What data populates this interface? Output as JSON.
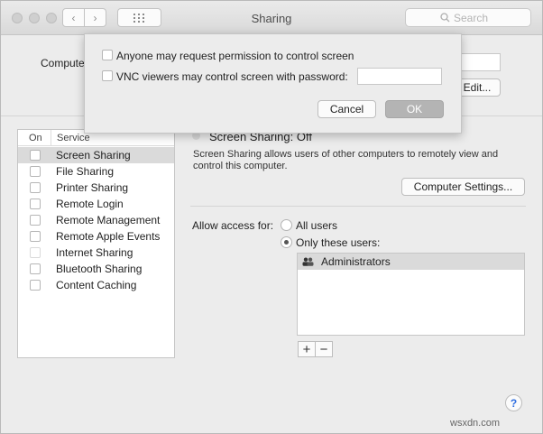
{
  "window": {
    "title": "Sharing"
  },
  "search": {
    "placeholder": "Search"
  },
  "computer_name": {
    "label": "Computer Name:",
    "edit_button": "Edit..."
  },
  "services": {
    "header_on": "On",
    "header_service": "Service",
    "items": [
      {
        "label": "Screen Sharing",
        "selected": true
      },
      {
        "label": "File Sharing"
      },
      {
        "label": "Printer Sharing"
      },
      {
        "label": "Remote Login"
      },
      {
        "label": "Remote Management"
      },
      {
        "label": "Remote Apple Events"
      },
      {
        "label": "Internet Sharing"
      },
      {
        "label": "Bluetooth Sharing"
      },
      {
        "label": "Content Caching"
      }
    ]
  },
  "screen_sharing": {
    "status": "Screen Sharing: Off",
    "description": "Screen Sharing allows users of other computers to remotely view and control this computer.",
    "settings_button": "Computer Settings..."
  },
  "access": {
    "label": "Allow access for:",
    "all_users": "All users",
    "only_these_users": "Only these users:",
    "selected_option": "only_these_users",
    "users": [
      {
        "name": "Administrators"
      }
    ],
    "add": "+",
    "remove": "−"
  },
  "sheet": {
    "option_request": "Anyone may request permission to control screen",
    "option_vnc": "VNC viewers may control screen with password:",
    "cancel": "Cancel",
    "ok": "OK"
  },
  "help": "?",
  "watermark": "wsxdn.com"
}
